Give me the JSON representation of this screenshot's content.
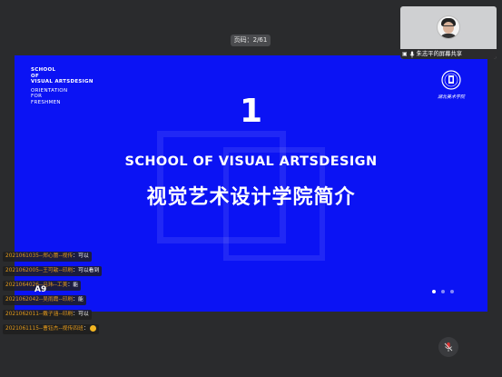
{
  "page_indicator": "页码：2/61",
  "slide": {
    "school_lines": [
      "SCHOOL",
      "OF",
      "VISUAL ARTSDESIGN"
    ],
    "orientation_lines": [
      "ORIENTATION",
      "FOR",
      "FRESHMEN"
    ],
    "logo_text": "湖北美术学院",
    "number": "1",
    "title_en": "SCHOOL OF VISUAL ARTSDESIGN",
    "title_cn": "视觉艺术设计学院简介",
    "dots": 3,
    "active_dot": 0
  },
  "video": {
    "share_label": "朱志平的屏幕共享",
    "share_icon": "screen-share-icon",
    "mic_icon": "microphone-icon"
  },
  "chat": [
    {
      "sender": "2021061035--郑心蕾--视传",
      "sep": "：",
      "text": "可以",
      "emoji": false
    },
    {
      "sender": "2021062005--王可歆--印刷",
      "sep": "：",
      "text": "可以看到",
      "emoji": false
    },
    {
      "sender": "2021064026--吕玮--工美",
      "sep": "：",
      "text": "能",
      "emoji": false
    },
    {
      "sender": "2021062042--吴雨霞--印刷",
      "sep": "：",
      "text": "能",
      "emoji": false
    },
    {
      "sender": "2021062011--戴子涵--印刷",
      "sep": "：",
      "text": "可以",
      "emoji": false
    },
    {
      "sender": "2021061115--曹钰杰--视传四班",
      "sep": "：",
      "text": "",
      "emoji": true
    }
  ],
  "overlay_label": "A9",
  "mic_button_icon": "microphone-icon"
}
